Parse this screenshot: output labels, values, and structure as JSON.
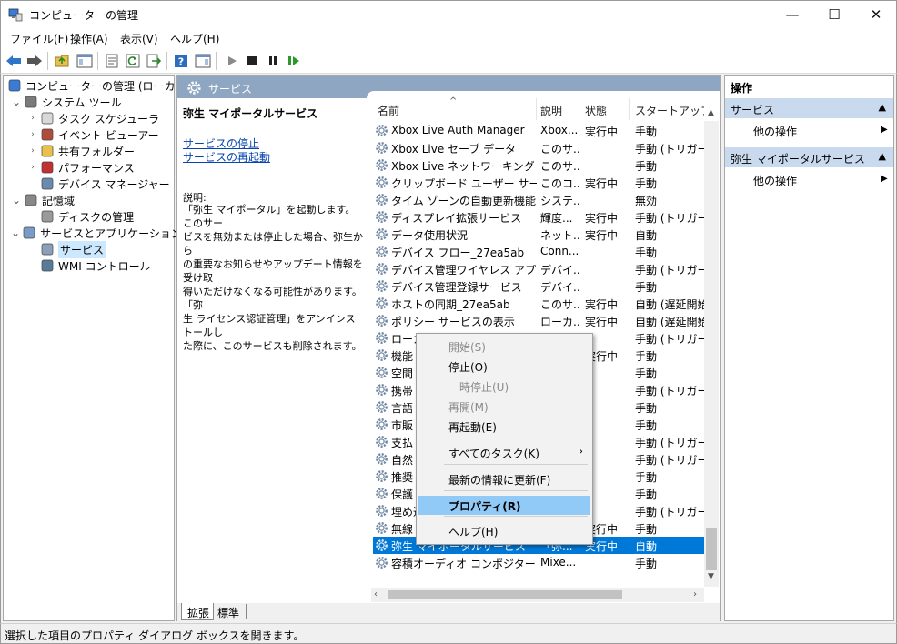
{
  "window": {
    "title": "コンピューターの管理",
    "minimize_glyph": "—",
    "maximize_glyph": "☐",
    "close_glyph": "✕"
  },
  "menu": [
    "ファイル(F)",
    "操作(A)",
    "表示(V)",
    "ヘルプ(H)"
  ],
  "tree": [
    {
      "label": "コンピューターの管理 (ローカル)",
      "level": 0,
      "expander": "",
      "icon": "computer-management-icon"
    },
    {
      "label": "システム ツール",
      "level": 1,
      "expander": "⌄",
      "icon": "system-tools-icon"
    },
    {
      "label": "タスク スケジューラ",
      "level": 2,
      "expander": "›",
      "icon": "clock-icon"
    },
    {
      "label": "イベント ビューアー",
      "level": 2,
      "expander": "›",
      "icon": "event-viewer-icon"
    },
    {
      "label": "共有フォルダー",
      "level": 2,
      "expander": "›",
      "icon": "shared-folder-icon"
    },
    {
      "label": "パフォーマンス",
      "level": 2,
      "expander": "›",
      "icon": "performance-icon"
    },
    {
      "label": "デバイス マネージャー",
      "level": 2,
      "expander": "",
      "icon": "device-manager-icon"
    },
    {
      "label": "記憶域",
      "level": 1,
      "expander": "⌄",
      "icon": "storage-icon"
    },
    {
      "label": "ディスクの管理",
      "level": 2,
      "expander": "",
      "icon": "disk-icon"
    },
    {
      "label": "サービスとアプリケーション",
      "level": 1,
      "expander": "⌄",
      "icon": "services-apps-icon"
    },
    {
      "label": "サービス",
      "level": 2,
      "expander": "",
      "icon": "services-icon",
      "selected": true
    },
    {
      "label": "WMI コントロール",
      "level": 2,
      "expander": "",
      "icon": "wmi-icon"
    }
  ],
  "services_header": "サービス",
  "detail": {
    "service_name": "弥生 マイポータルサービス",
    "link_stop": "サービスの停止",
    "link_restart": "サービスの再起動",
    "desc_label": "説明:",
    "desc_lines": [
      "「弥生 マイポータル」を起動します。このサー",
      "ビスを無効または停止した場合、弥生から",
      "の重要なお知らせやアップデート情報を受け取",
      "得いただけなくなる可能性があります。「弥",
      "生 ライセンス認証管理」をアンインストールし",
      "た際に、このサービスも削除されます。"
    ]
  },
  "columns": {
    "name": "名前",
    "desc": "説明",
    "state": "状態",
    "startup": "スタートアップの種"
  },
  "sort_glyph": "^",
  "rows": [
    {
      "name": "Xbox Live Auth Manager",
      "desc": "Xbox...",
      "state": "実行中",
      "startup": "手動"
    },
    {
      "name": "Xbox Live セーブ データ",
      "desc": "このサ...",
      "state": "",
      "startup": "手動 (トリガー開"
    },
    {
      "name": "Xbox Live ネットワーキング サー...",
      "desc": "このサ...",
      "state": "",
      "startup": "手動"
    },
    {
      "name": "クリップボード ユーザー サービス_...",
      "desc": "このコ...",
      "state": "実行中",
      "startup": "手動"
    },
    {
      "name": "タイム ゾーンの自動更新機能",
      "desc": "システ...",
      "state": "",
      "startup": "無効"
    },
    {
      "name": "ディスプレイ拡張サービス",
      "desc": "輝度...",
      "state": "実行中",
      "startup": "手動 (トリガー開"
    },
    {
      "name": "データ使用状況",
      "desc": "ネット...",
      "state": "実行中",
      "startup": "自動"
    },
    {
      "name": "デバイス フロー_27ea5ab",
      "desc": "Conn...",
      "state": "",
      "startup": "手動"
    },
    {
      "name": "デバイス管理ワイヤレス アプリケ...",
      "desc": "デバイ...",
      "state": "",
      "startup": "手動 (トリガー開"
    },
    {
      "name": "デバイス管理登録サービス",
      "desc": "デバイ...",
      "state": "",
      "startup": "手動"
    },
    {
      "name": "ホストの同期_27ea5ab",
      "desc": "このサ...",
      "state": "実行中",
      "startup": "自動 (遅延開始"
    },
    {
      "name": "ポリシー サービスの表示",
      "desc": "ローカ...",
      "state": "実行中",
      "startup": "自動 (遅延開始"
    },
    {
      "name": "ローカ",
      "desc": "",
      "state": "",
      "startup": "手動 (トリガー開"
    },
    {
      "name": "機能",
      "desc": "",
      "state": "実行中",
      "startup": "手動"
    },
    {
      "name": "空間",
      "desc": "",
      "state": "",
      "startup": "手動"
    },
    {
      "name": "携帯",
      "desc": "",
      "state": "",
      "startup": "手動 (トリガー開"
    },
    {
      "name": "言語",
      "desc": "",
      "state": "",
      "startup": "手動"
    },
    {
      "name": "市販",
      "desc": "",
      "state": "",
      "startup": "手動"
    },
    {
      "name": "支払",
      "desc": "",
      "state": "",
      "startup": "手動 (トリガー開"
    },
    {
      "name": "自然",
      "desc": "",
      "state": "",
      "startup": "手動 (トリガー開"
    },
    {
      "name": "推奨",
      "desc": "",
      "state": "",
      "startup": "手動"
    },
    {
      "name": "保護",
      "desc": "",
      "state": "",
      "startup": "手動"
    },
    {
      "name": "埋め込",
      "desc": "",
      "state": "",
      "startup": "手動 (トリガー開"
    },
    {
      "name": "無線",
      "desc": "",
      "state": "実行中",
      "startup": "手動"
    },
    {
      "name": "弥生 マイポータルサービス",
      "desc": "「弥...",
      "state": "実行中",
      "startup": "自動",
      "selected": true
    },
    {
      "name": "容積オーディオ コンポジター サー...",
      "desc": "Mixe...",
      "state": "",
      "startup": "手動"
    }
  ],
  "tabs": {
    "extended": "拡張",
    "standard": "標準"
  },
  "actions": {
    "header": "操作",
    "section1": "サービス",
    "more1": "他の操作",
    "section2": "弥生 マイポータルサービス",
    "more2": "他の操作"
  },
  "context_menu": [
    {
      "label": "開始(S)",
      "disabled": true
    },
    {
      "label": "停止(O)",
      "disabled": false
    },
    {
      "label": "一時停止(U)",
      "disabled": true
    },
    {
      "label": "再開(M)",
      "disabled": true
    },
    {
      "label": "再起動(E)",
      "disabled": false
    },
    {
      "label": "すべてのタスク(K)",
      "disabled": false,
      "submenu": true
    },
    {
      "label": "最新の情報に更新(F)",
      "disabled": false
    },
    {
      "label": "プロパティ(R)",
      "disabled": false,
      "highlighted": true,
      "bold": true
    },
    {
      "label": "ヘルプ(H)",
      "disabled": false
    }
  ],
  "status": "選択した項目のプロパティ ダイアログ ボックスを開きます。",
  "colors": {
    "selection": "#0078d7",
    "menu_highlight": "#91c9f7",
    "panel_header": "#8ea6c2",
    "action_section": "#c9d9ee"
  }
}
